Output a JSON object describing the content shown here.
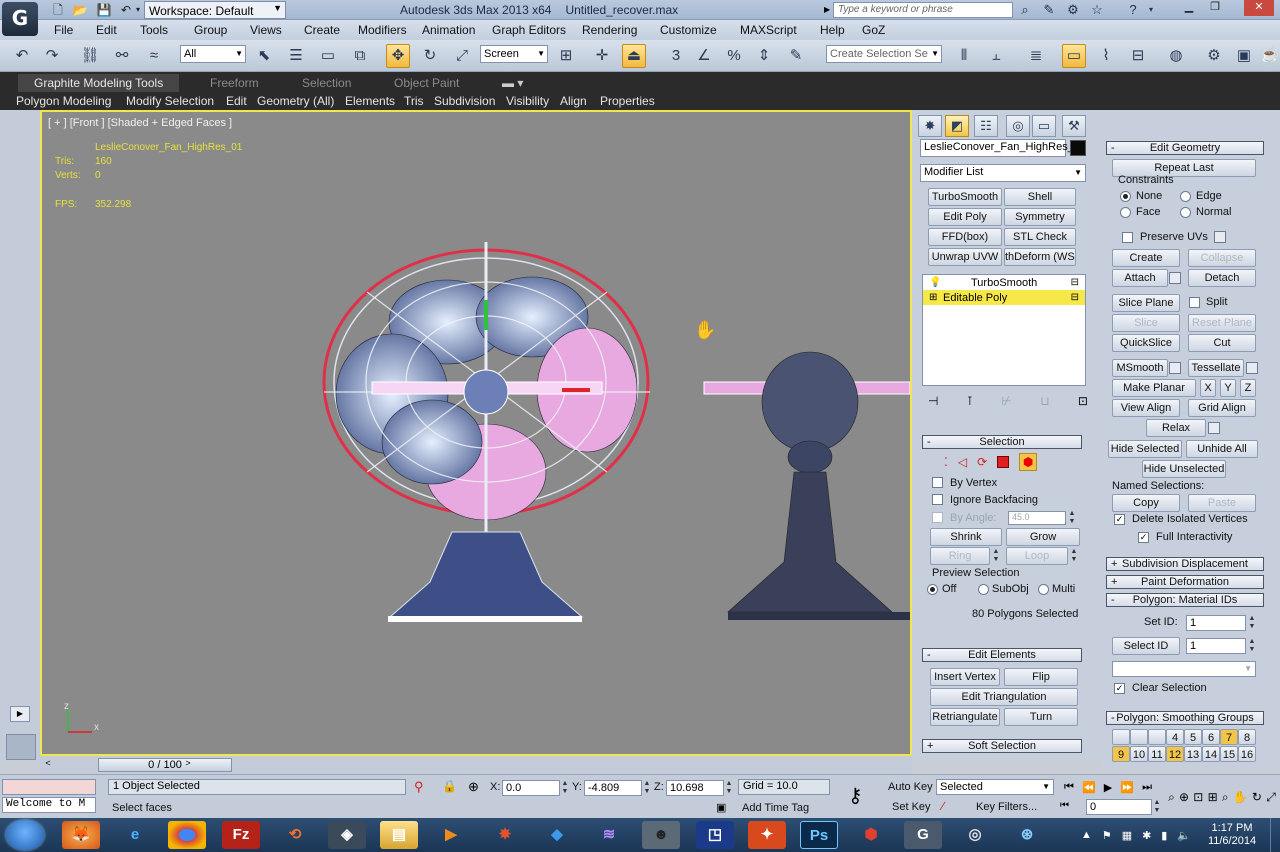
{
  "titlebar": {
    "app_icon": "3ds-max-logo",
    "workspace": "Workspace: Default",
    "app_title": "Autodesk 3ds Max  2013 x64",
    "file_name": "Untitled_recover.max",
    "search_placeholder": "Type a keyword or phrase"
  },
  "menu": [
    "File",
    "Edit",
    "Tools",
    "Group",
    "Views",
    "Create",
    "Modifiers",
    "Animation",
    "Graph Editors",
    "Rendering",
    "Customize",
    "MAXScript",
    "Help",
    "GoZ"
  ],
  "toolbar": {
    "selection_filter": "All",
    "ref_coord": "Screen",
    "named_selection_placeholder": "Create Selection Se"
  },
  "graphite": {
    "tabs": [
      "Graphite Modeling Tools",
      "Freeform",
      "Selection",
      "Object Paint"
    ],
    "subtabs": [
      "Polygon Modeling",
      "Modify Selection",
      "Edit",
      "Geometry (All)",
      "Elements",
      "Tris",
      "Subdivision",
      "Visibility",
      "Align",
      "Properties"
    ]
  },
  "viewport": {
    "label": "[ + ] [Front ] [Shaded + Edged Faces ]",
    "object_name": "LeslieConover_Fan_HighRes_01",
    "tris_label": "Tris:",
    "tris_value": "160",
    "verts_label": "Verts:",
    "verts_value": "0",
    "fps_label": "FPS:",
    "fps_value": "352.298",
    "axis_z": "z",
    "axis_x": "x",
    "accent": "#f0e650",
    "fan_cage_color": "#e03048",
    "selected_face_color": "#e8a8e0"
  },
  "command_panel": {
    "object_name": "LeslieConover_Fan_HighRes_",
    "modifier_list": "Modifier List",
    "modifier_buttons": [
      "TurboSmooth",
      "Shell",
      "Edit Poly",
      "Symmetry",
      "FFD(box)",
      "STL Check",
      "Unwrap UVW",
      "thDeform (WSI"
    ],
    "stack": [
      "TurboSmooth",
      "Editable Poly"
    ],
    "selection": {
      "title": "Selection",
      "by_vertex": "By Vertex",
      "ignore_backfacing": "Ignore Backfacing",
      "by_angle": "By Angle:",
      "angle_value": "45.0",
      "shrink": "Shrink",
      "grow": "Grow",
      "ring": "Ring",
      "loop": "Loop",
      "preview_title": "Preview Selection",
      "preview_options": [
        "Off",
        "SubObj",
        "Multi"
      ],
      "status": "80 Polygons Selected"
    },
    "edit_elements": {
      "title": "Edit Elements",
      "insert_vertex": "Insert Vertex",
      "flip": "Flip",
      "edit_triangulation": "Edit Triangulation",
      "retriangulate": "Retriangulate",
      "turn": "Turn"
    },
    "soft_selection": "Soft Selection"
  },
  "edit_geometry": {
    "title": "Edit Geometry",
    "repeat_last": "Repeat Last",
    "constraints": "Constraints",
    "constraint_options": [
      "None",
      "Edge",
      "Face",
      "Normal"
    ],
    "preserve_uvs": "Preserve UVs",
    "create": "Create",
    "collapse": "Collapse",
    "attach": "Attach",
    "detach": "Detach",
    "slice_plane": "Slice Plane",
    "split": "Split",
    "slice": "Slice",
    "reset_plane": "Reset Plane",
    "quickslice": "QuickSlice",
    "cut": "Cut",
    "msmooth": "MSmooth",
    "tessellate": "Tessellate",
    "make_planar": "Make Planar",
    "x": "X",
    "y": "Y",
    "z": "Z",
    "view_align": "View Align",
    "grid_align": "Grid Align",
    "relax": "Relax",
    "hide_selected": "Hide Selected",
    "unhide_all": "Unhide All",
    "hide_unselected": "Hide Unselected",
    "named_selections": "Named Selections:",
    "copy": "Copy",
    "paste": "Paste",
    "delete_isolated": "Delete Isolated Vertices",
    "full_interactivity": "Full Interactivity",
    "subdivision_displacement": "Subdivision Displacement",
    "paint_deformation": "Paint Deformation",
    "material_ids": "Polygon: Material IDs",
    "set_id": "Set ID:",
    "set_id_value": "1",
    "select_id": "Select ID",
    "select_id_value": "1",
    "clear_selection": "Clear Selection",
    "smoothing_groups": "Polygon: Smoothing Groups",
    "sg_row1": [
      "",
      "",
      "",
      "4",
      "5",
      "6",
      "7",
      "8"
    ],
    "sg_row2": [
      "9",
      "10",
      "11",
      "12",
      "13",
      "14",
      "15",
      "16"
    ]
  },
  "timeline": {
    "frame": "0 / 100"
  },
  "status": {
    "script_listener": "Welcome to M",
    "selected": "1 Object Selected",
    "prompt": "Select faces",
    "x_label": "X:",
    "x_value": "0.0",
    "y_label": "Y:",
    "y_value": "-4.809",
    "z_label": "Z:",
    "z_value": "10.698",
    "grid": "Grid = 10.0",
    "add_time_tag": "Add Time Tag",
    "auto_key": "Auto Key",
    "set_key": "Set Key",
    "key_mode": "Selected",
    "key_filters": "Key Filters...",
    "frame_value": "0"
  },
  "taskbar": {
    "time": "1:17 PM",
    "date": "11/6/2014",
    "apps": [
      "firefox",
      "internet-explorer",
      "chrome",
      "filezilla",
      "autodesk",
      "game",
      "explorer",
      "media-player",
      "app",
      "dropbox",
      "app",
      "character",
      "app",
      "mudbox",
      "photoshop",
      "sketchup",
      "3ds-max",
      "app",
      "app"
    ]
  }
}
